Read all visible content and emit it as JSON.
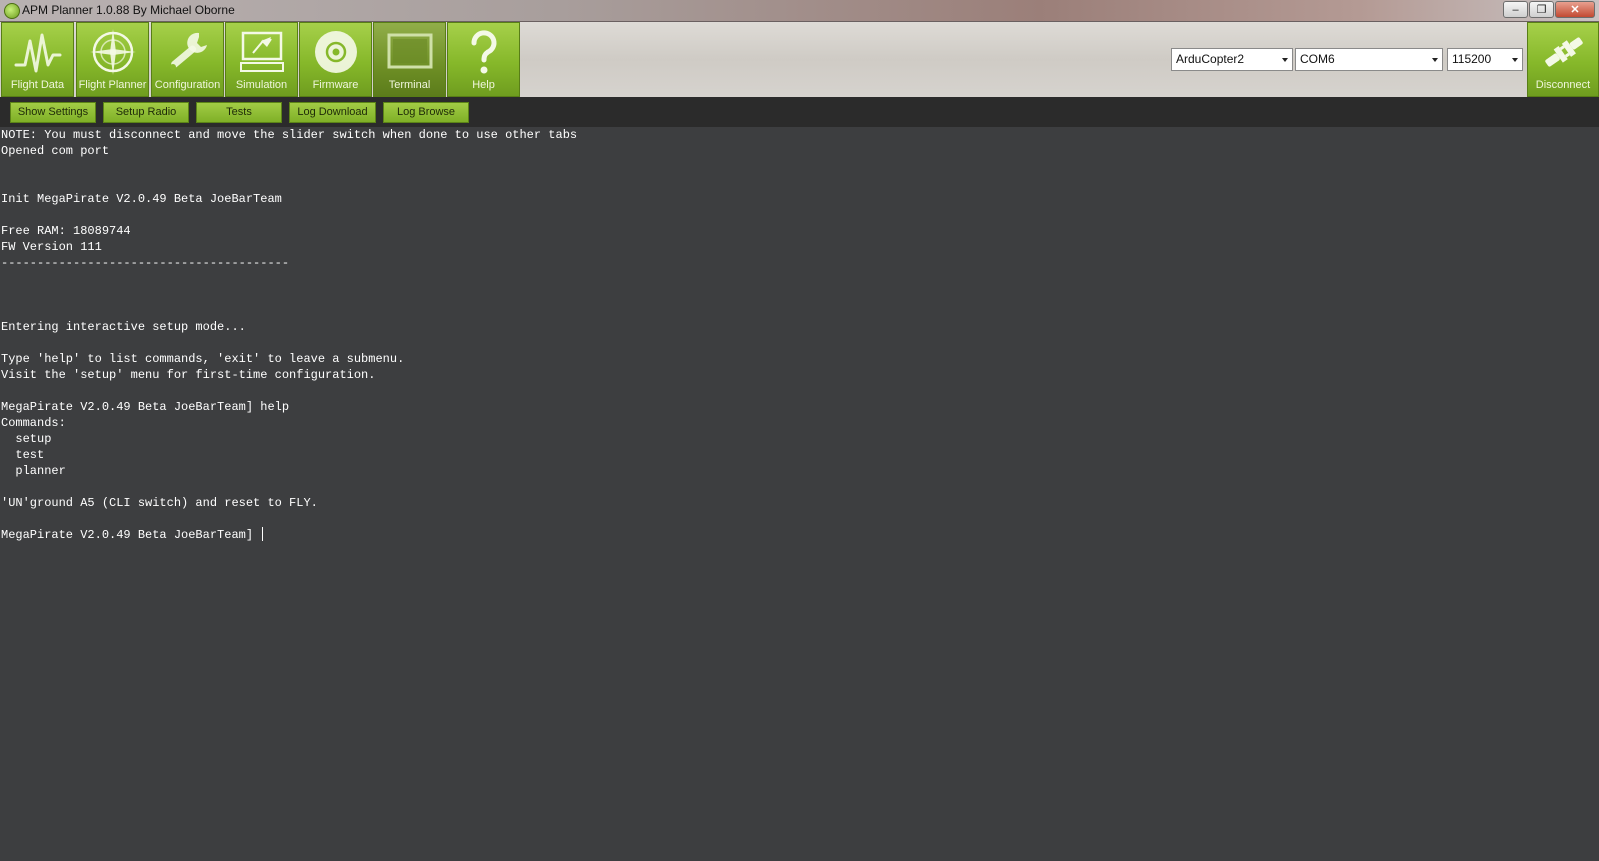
{
  "window": {
    "title": "APM Planner 1.0.88  By Michael Oborne",
    "controls": {
      "minimize": "–",
      "restore": "❐",
      "close": "✕"
    }
  },
  "nav": [
    {
      "label": "Flight Data",
      "icon": "pulse-icon"
    },
    {
      "label": "Flight Planner",
      "icon": "compass-icon"
    },
    {
      "label": "Configuration",
      "icon": "wrench-icon"
    },
    {
      "label": "Simulation",
      "icon": "monitor-plane-icon"
    },
    {
      "label": "Firmware",
      "icon": "disc-icon"
    },
    {
      "label": "Terminal",
      "icon": "terminal-screen-icon",
      "active": true
    },
    {
      "label": "Help",
      "icon": "question-icon"
    }
  ],
  "connection": {
    "vehicle": "ArduCopter2",
    "port": "COM6",
    "baud": "115200",
    "disconnect_label": "Disconnect"
  },
  "subtoolbar": [
    "Show Settings",
    "Setup Radio",
    "Tests",
    "Log Download",
    "Log Browse"
  ],
  "terminal_lines": [
    "NOTE: You must disconnect and move the slider switch when done to use other tabs",
    "Opened com port",
    "",
    "",
    "Init MegaPirate V2.0.49 Beta JoeBarTeam",
    "",
    "Free RAM: 18089744",
    "FW Version 111",
    "----------------------------------------",
    "",
    "",
    "",
    "Entering interactive setup mode...",
    "",
    "Type 'help' to list commands, 'exit' to leave a submenu.",
    "Visit the 'setup' menu for first-time configuration.",
    "",
    "MegaPirate V2.0.49 Beta JoeBarTeam] help",
    "Commands:",
    "  setup",
    "  test",
    "  planner",
    "",
    "'UN'ground A5 (CLI switch) and reset to FLY.",
    "",
    "MegaPirate V2.0.49 Beta JoeBarTeam] "
  ]
}
